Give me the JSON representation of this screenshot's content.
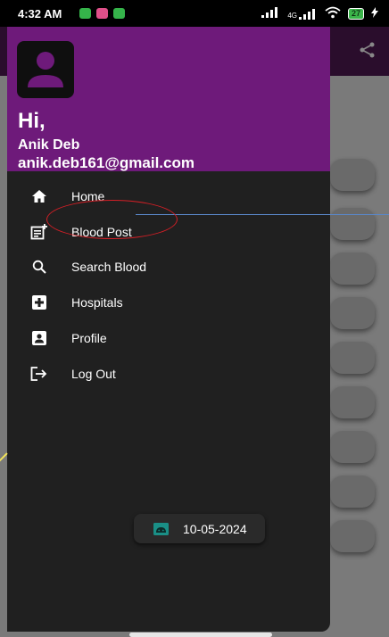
{
  "status_bar": {
    "time": "4:32 AM",
    "notification_icons": [
      "app-notification-green",
      "app-notification-pink",
      "app-notification-green"
    ],
    "signal_label": "4G",
    "battery_level": "27"
  },
  "drawer": {
    "header": {
      "greeting": "Hi,",
      "user_name": "Anik Deb",
      "email": "anik.deb161@gmail.com"
    },
    "items": [
      {
        "label": "Home",
        "icon": "home-icon"
      },
      {
        "label": "Blood Post",
        "icon": "post-add-icon"
      },
      {
        "label": "Search Blood",
        "icon": "search-icon"
      },
      {
        "label": "Hospitals",
        "icon": "hospital-icon"
      },
      {
        "label": "Profile",
        "icon": "profile-icon"
      },
      {
        "label": "Log Out",
        "icon": "logout-icon"
      }
    ],
    "date_chip": {
      "icon": "android-icon",
      "date": "10-05-2024"
    }
  },
  "colors": {
    "header_purple": "#6e1a7a",
    "drawer_bg": "#202020",
    "annotation_red": "#d41f26",
    "annotation_blue": "#5a87c9",
    "date_icon_teal": "#1a8f86"
  }
}
